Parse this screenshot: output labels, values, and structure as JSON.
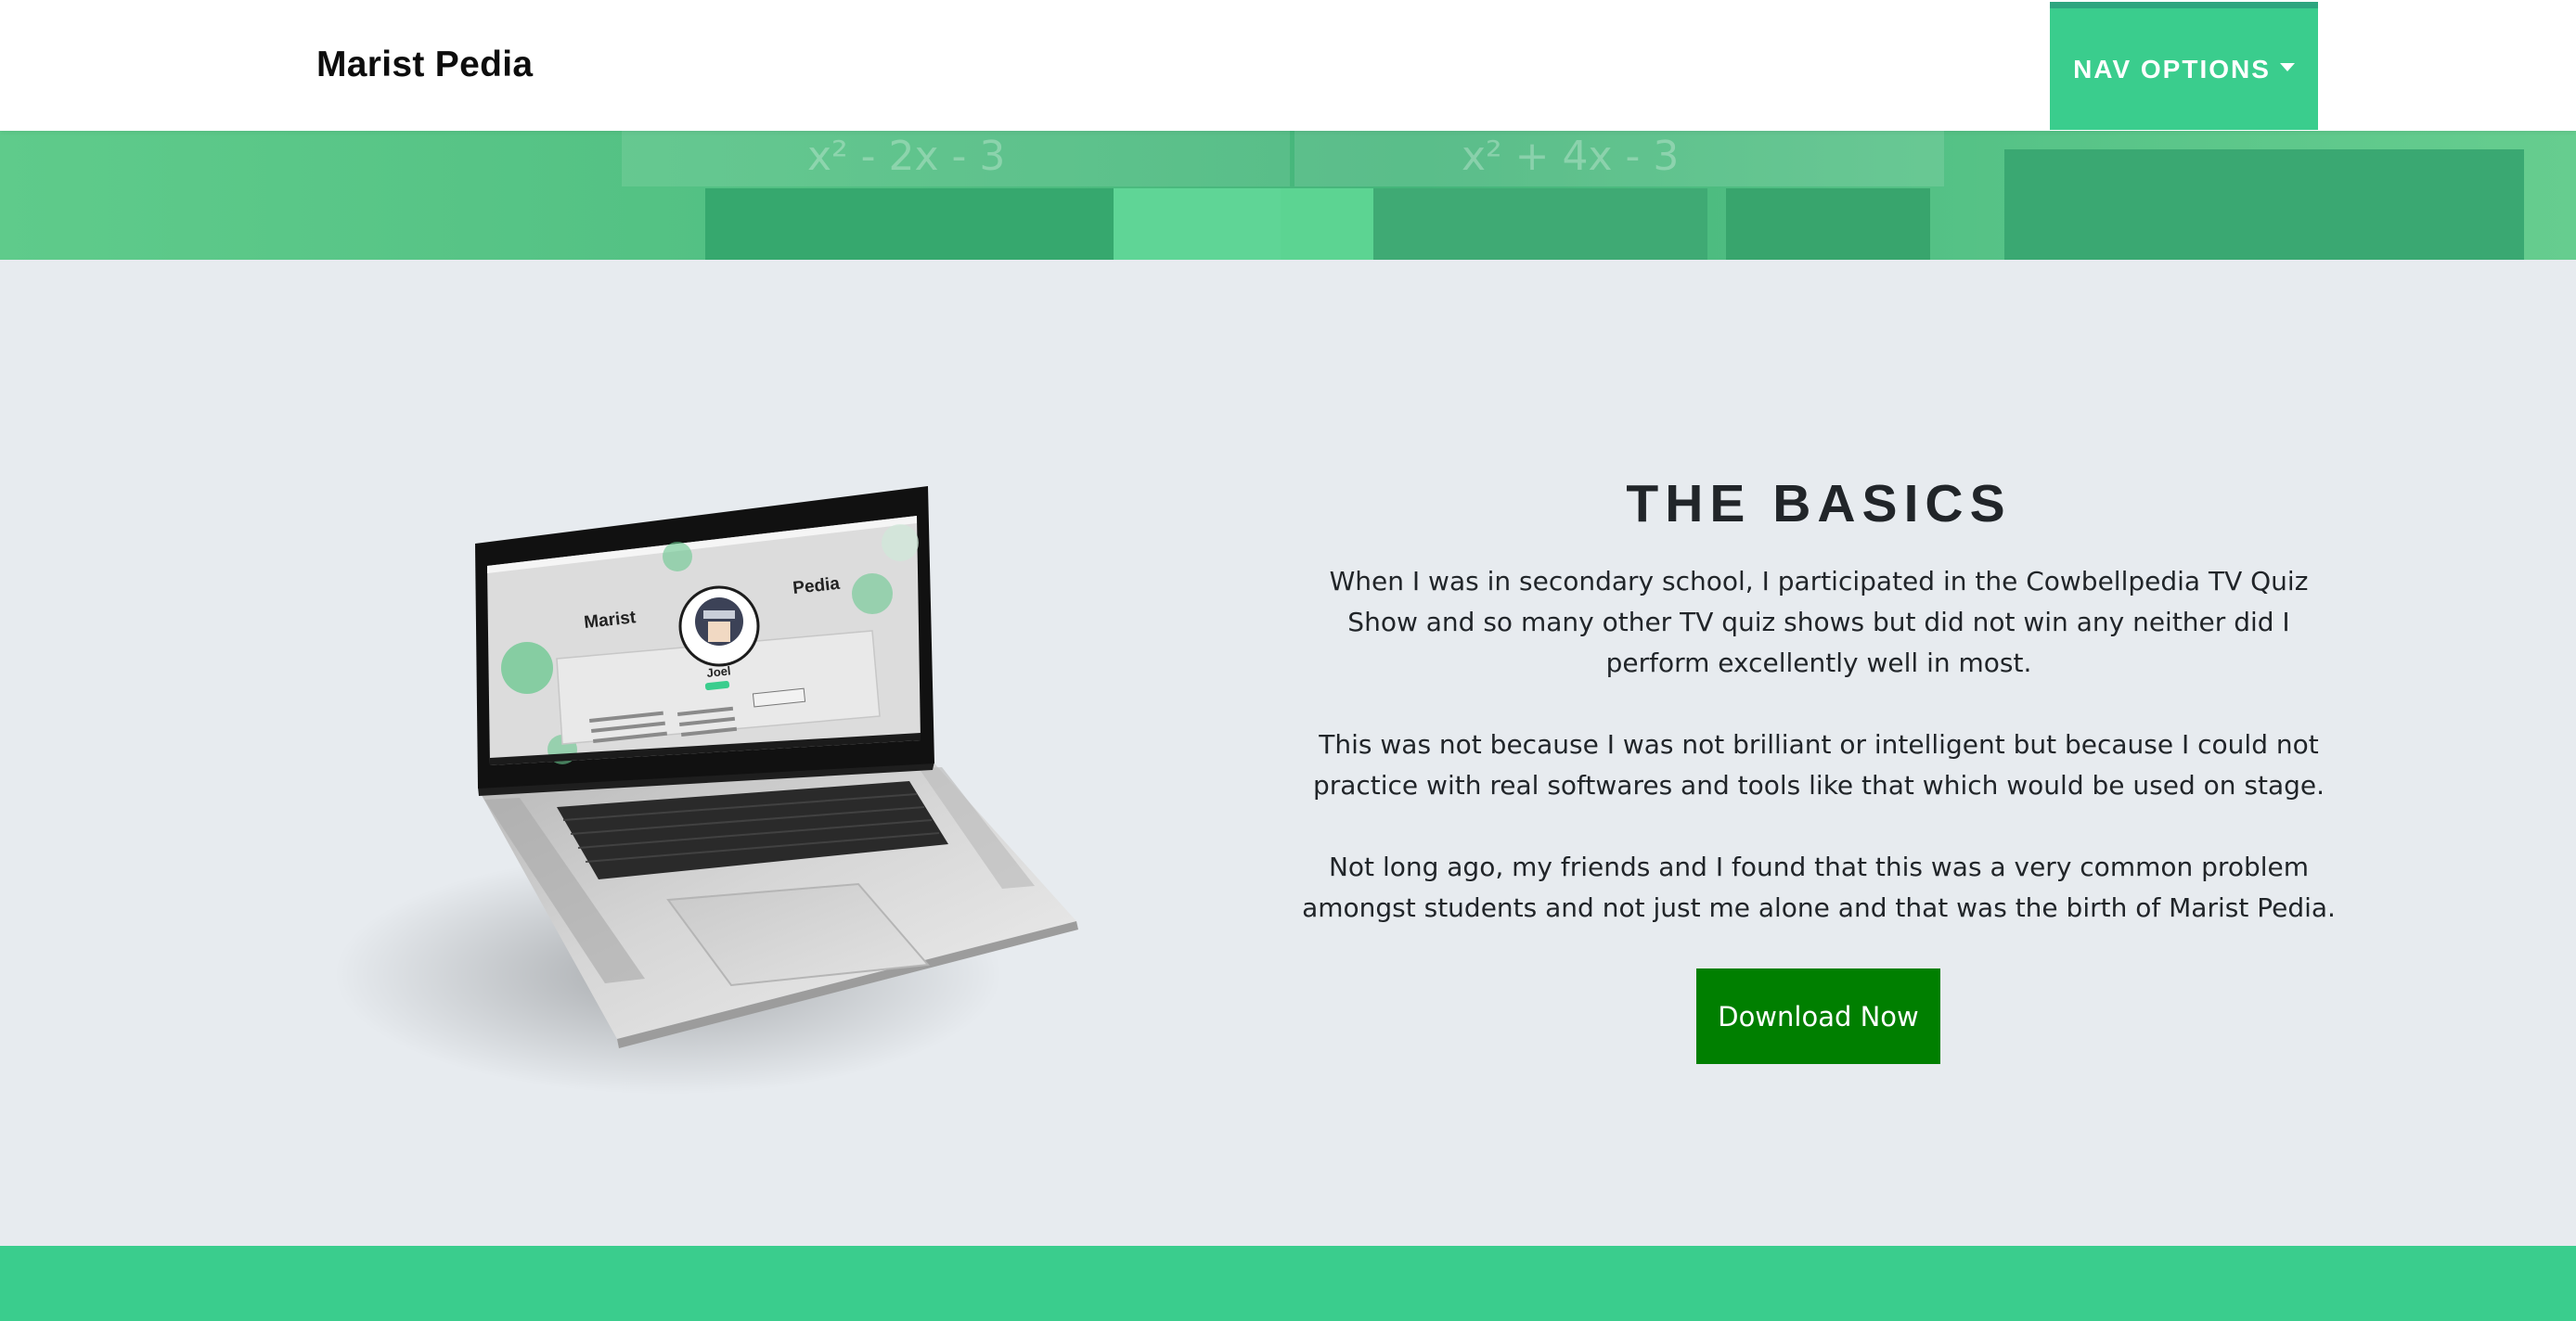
{
  "navbar": {
    "brand": "Marist Pedia",
    "nav_options_label": "NAV OPTIONS"
  },
  "hero": {
    "board_text_left": "x² - 2x - 3",
    "board_text_right": "x² + 4x - 3"
  },
  "laptop_screen": {
    "brand_left": "Marist",
    "brand_right": "Pedia",
    "user_name": "Joel"
  },
  "main": {
    "title": "THE BASICS",
    "paragraphs": [
      "When I was in secondary school, I participated in the Cowbellpedia TV Quiz Show and so many other TV quiz shows but did not win any neither did I perform excellently well in most.",
      "This was not because I was not brilliant or intelligent but because I could not practice with real softwares and tools like that which would be used on stage.",
      "Not long ago, my friends and I found that this was a very common problem amongst students and not just me alone and that was the birth of Marist Pedia."
    ],
    "download_label": "Download Now"
  },
  "colors": {
    "accent": "#3acd8d",
    "button": "#007f00",
    "background": "#e7ebef",
    "text": "#212529"
  }
}
